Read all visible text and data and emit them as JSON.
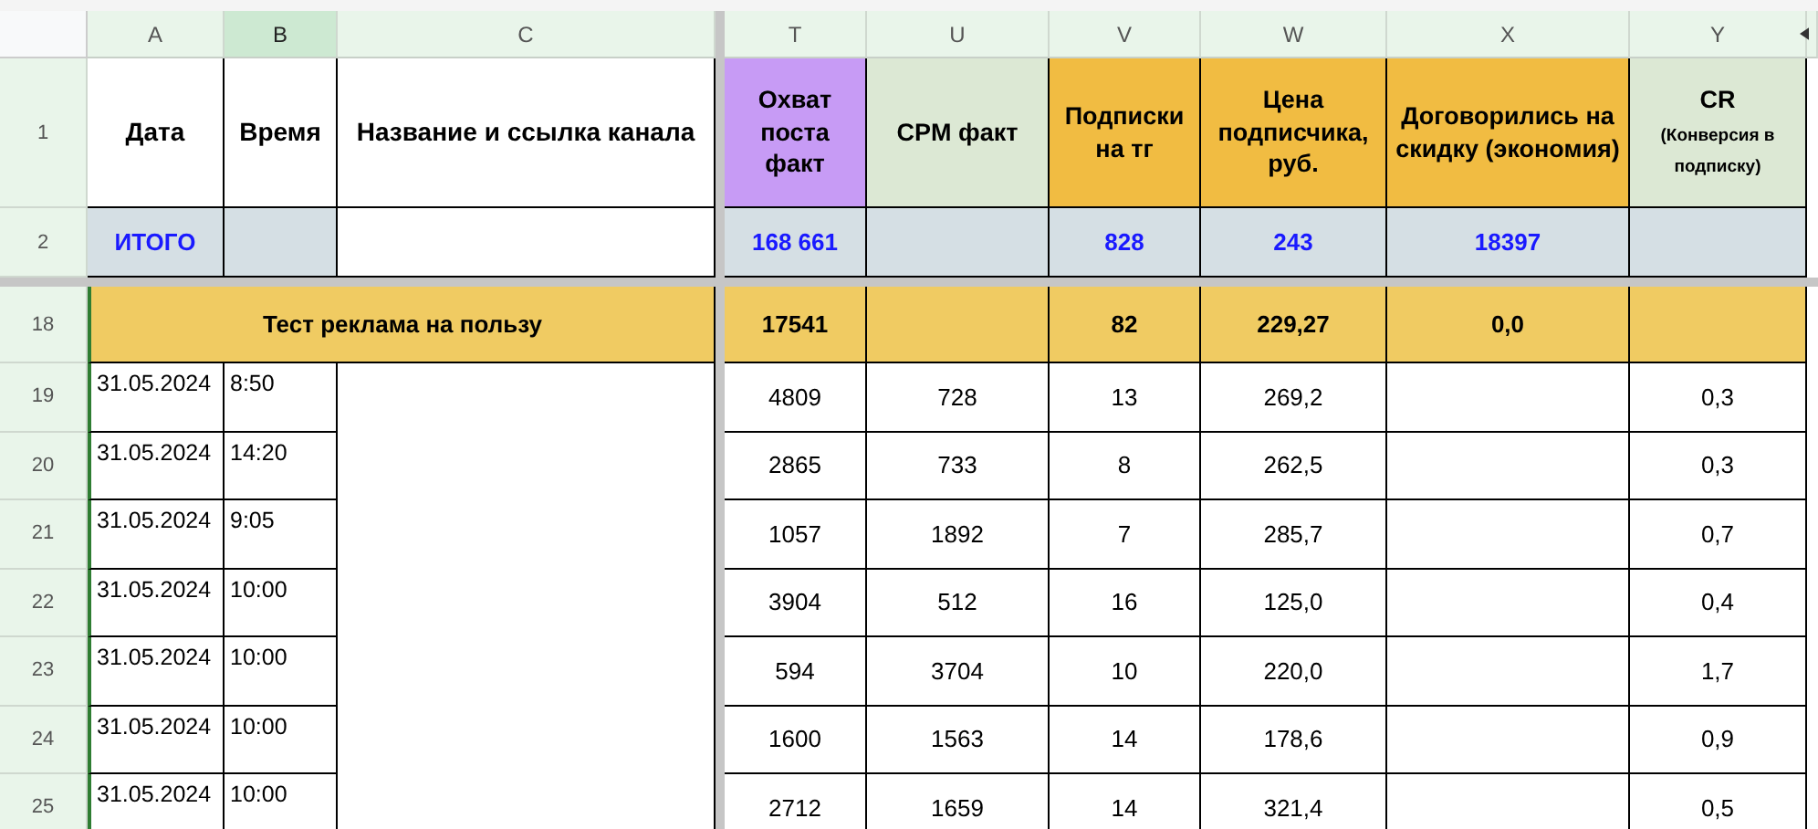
{
  "column_letters": [
    {
      "letter": "A",
      "selected": false
    },
    {
      "letter": "B",
      "selected": true
    },
    {
      "letter": "C",
      "selected": false
    },
    {
      "letter": "T",
      "selected": false
    },
    {
      "letter": "U",
      "selected": false
    },
    {
      "letter": "V",
      "selected": false
    },
    {
      "letter": "W",
      "selected": false
    },
    {
      "letter": "X",
      "selected": false
    },
    {
      "letter": "Y",
      "selected": false
    }
  ],
  "header_row": {
    "row": "1",
    "cells": [
      {
        "text": "Дата",
        "color": "#ffffff"
      },
      {
        "text": "Время",
        "color": "#ffffff"
      },
      {
        "text": "Название и ссылка канала",
        "color": "#ffffff"
      },
      {
        "text": "Охват поста факт",
        "color": "#c79bf5"
      },
      {
        "text": "CPM факт",
        "color": "#dce8d4"
      },
      {
        "text": "Подписки на тг",
        "color": "#f1bc42"
      },
      {
        "text": "Цена подписчика, руб.",
        "color": "#f1bc42"
      },
      {
        "text": "Договорились на скидку (экономия)",
        "color": "#f1bc42"
      },
      {
        "text": "CR",
        "note": "(Конверсия в подписку)",
        "color": "#dce8d4"
      }
    ]
  },
  "totals_row": {
    "row": "2",
    "date": "ИТОГО",
    "reach": "168 661",
    "subs": "828",
    "price": "243",
    "discount": "18397"
  },
  "group_row": {
    "row": "18",
    "title": "Тест реклама на пользу",
    "reach": "17541",
    "subs": "82",
    "price": "229,27",
    "discount": "0,0"
  },
  "rows": [
    {
      "row": "19",
      "date": "31.05.2024",
      "time": "8:50",
      "reach": "4809",
      "cpm": "728",
      "subs": "13",
      "price": "269,2",
      "cr": "0,3"
    },
    {
      "row": "20",
      "date": "31.05.2024",
      "time": "14:20",
      "reach": "2865",
      "cpm": "733",
      "subs": "8",
      "price": "262,5",
      "cr": "0,3"
    },
    {
      "row": "21",
      "date": "31.05.2024",
      "time": "9:05",
      "reach": "1057",
      "cpm": "1892",
      "subs": "7",
      "price": "285,7",
      "cr": "0,7"
    },
    {
      "row": "22",
      "date": "31.05.2024",
      "time": "10:00",
      "reach": "3904",
      "cpm": "512",
      "subs": "16",
      "price": "125,0",
      "cr": "0,4"
    },
    {
      "row": "23",
      "date": "31.05.2024",
      "time": "10:00",
      "reach": "594",
      "cpm": "3704",
      "subs": "10",
      "price": "220,0",
      "cr": "1,7"
    },
    {
      "row": "24",
      "date": "31.05.2024",
      "time": "10:00",
      "reach": "1600",
      "cpm": "1563",
      "subs": "14",
      "price": "178,6",
      "cr": "0,9"
    },
    {
      "row": "25",
      "date": "31.05.2024",
      "time": "10:00",
      "reach": "2712",
      "cpm": "1659",
      "subs": "14",
      "price": "321,4",
      "cr": "0,5"
    }
  ]
}
